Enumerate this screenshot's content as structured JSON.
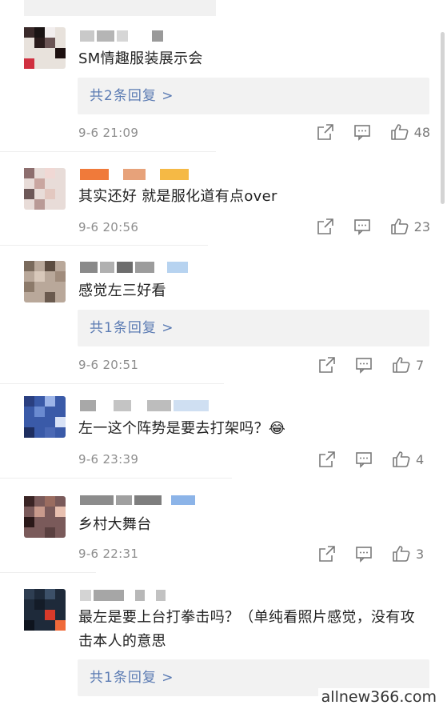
{
  "comments": [
    {
      "text": "SM情趣服装展示会",
      "replies": "共2条回复 >",
      "time": "9-6 21:09",
      "likes": "48"
    },
    {
      "text": "其实还好 就是服化道有点over",
      "replies": "",
      "time": "9-6 20:56",
      "likes": "23"
    },
    {
      "text": "感觉左三好看",
      "replies": "共1条回复 >",
      "time": "9-6 20:51",
      "likes": "7"
    },
    {
      "text": "左一这个阵势是要去打架吗？😂",
      "replies": "",
      "time": "9-6 23:39",
      "likes": "4"
    },
    {
      "text": "乡村大舞台",
      "replies": "",
      "time": "9-6 22:31",
      "likes": "3"
    },
    {
      "text": "最左是要上台打拳击吗？（单纯看照片感觉，没有攻击本人的意思",
      "replies": "共1条回复 >",
      "time": "",
      "likes": ""
    }
  ],
  "watermark": "allnew366.com",
  "icons": {
    "share": "share-icon",
    "comment": "comment-icon",
    "like": "thumbs-up-icon"
  }
}
